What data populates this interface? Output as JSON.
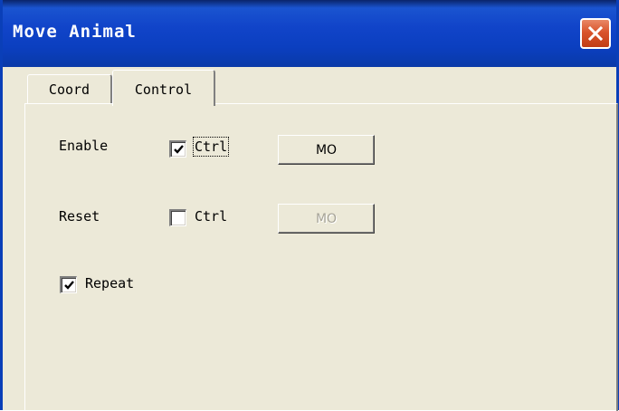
{
  "window": {
    "title": "Move Animal"
  },
  "tabs": {
    "coord": "Coord",
    "control": "Control",
    "active": "Control"
  },
  "enable": {
    "label": "Enable",
    "checkbox_label": "Ctrl",
    "checked": true,
    "button_label": "MO",
    "button_enabled": true
  },
  "reset": {
    "label": "Reset",
    "checkbox_label": "Ctrl",
    "checked": false,
    "button_label": "MO",
    "button_enabled": false
  },
  "repeat": {
    "label": "Repeat",
    "checked": true
  },
  "icons": {
    "close": "close-icon",
    "check": "checkmark-icon"
  },
  "colors": {
    "title_bar": "#1144c9",
    "close_button": "#d9542c",
    "dialog_bg": "#ece9d8"
  }
}
